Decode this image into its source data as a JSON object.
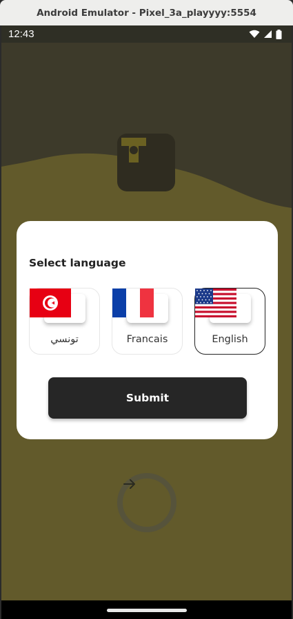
{
  "window": {
    "title": "Android Emulator - Pixel_3a_playyyy:5554"
  },
  "status_bar": {
    "time": "12:43",
    "icons": [
      "wifi-icon",
      "signal-icon",
      "battery-icon"
    ]
  },
  "background": {
    "logo_icon": "app-logo-icon",
    "next_icon": "arrow-right-icon"
  },
  "dialog": {
    "title": "Select language",
    "languages": [
      {
        "label": "تونسي",
        "flag": "tunisia-flag-icon",
        "selected": false
      },
      {
        "label": "Francais",
        "flag": "france-flag-icon",
        "selected": false
      },
      {
        "label": "English",
        "flag": "usa-flag-icon",
        "selected": true
      }
    ],
    "submit_label": "Submit"
  },
  "colors": {
    "overlay_background": "#625a2b",
    "dialog": "#ffffff",
    "submit_button": "#262626",
    "selected_border": "#222222"
  }
}
